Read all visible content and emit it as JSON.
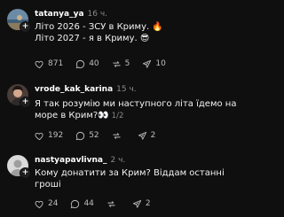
{
  "comments": [
    {
      "username": "tatanya_ya",
      "time": "16 ч.",
      "lines": [
        "Літо 2026 - ЗСУ в Криму. 🔥",
        "Літо 2027 - я в Криму. 😎"
      ],
      "page_indicator": "",
      "likes": "871",
      "replies": "40",
      "reposts": "5",
      "shares": "10",
      "avatar": "avatar-photo-sea"
    },
    {
      "username": "vrode_kak_karina",
      "time": "15 ч.",
      "lines": [
        "Я так розумію ми наступного літа їдемо на",
        "море в Крим?👀"
      ],
      "page_indicator": "1/2",
      "likes": "192",
      "replies": "52",
      "reposts": "",
      "shares": "2",
      "avatar": "avatar-photo-person"
    },
    {
      "username": "nastyapavlivna_",
      "time": "2 ч.",
      "lines": [
        "Кому донатити за Крим? Віддам останні",
        "гроші"
      ],
      "page_indicator": "",
      "likes": "24",
      "replies": "44",
      "reposts": "",
      "shares": "2",
      "avatar": "avatar-default"
    }
  ],
  "colors": {
    "background": "#0f0f0f",
    "text": "#f2f2f2",
    "muted": "#8a8a8a"
  }
}
